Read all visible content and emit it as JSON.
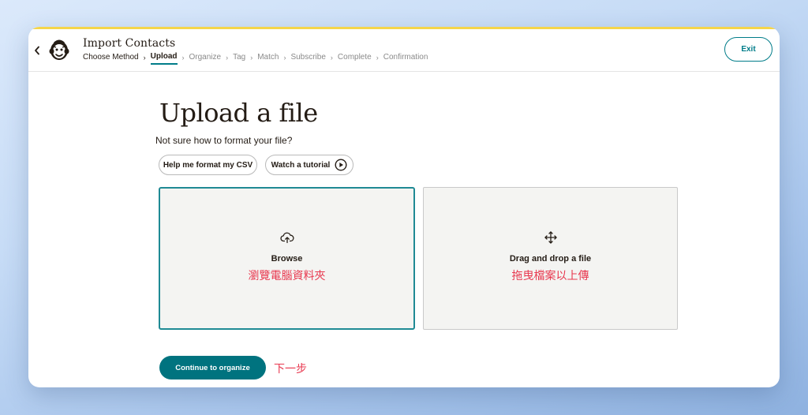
{
  "colors": {
    "accent_bar": "#f5d54a",
    "primary": "#007c89",
    "annotation": "#e8384f",
    "text": "#241c15"
  },
  "header": {
    "title": "Import Contacts",
    "back_icon": "chevron-left-icon",
    "logo": "mailchimp-logo",
    "exit_label": "Exit"
  },
  "breadcrumb": {
    "steps": [
      {
        "label": "Choose Method",
        "state": "done"
      },
      {
        "label": "Upload",
        "state": "current"
      },
      {
        "label": "Organize",
        "state": "todo"
      },
      {
        "label": "Tag",
        "state": "todo"
      },
      {
        "label": "Match",
        "state": "todo"
      },
      {
        "label": "Subscribe",
        "state": "todo"
      },
      {
        "label": "Complete",
        "state": "todo"
      },
      {
        "label": "Confirmation",
        "state": "todo"
      }
    ]
  },
  "main": {
    "heading": "Upload a file",
    "subtext": "Not sure how to format your file?",
    "help_button": "Help me format my CSV",
    "tutorial_button": "Watch a tutorial",
    "tutorial_icon": "play-circle-icon",
    "browse": {
      "icon": "cloud-upload-icon",
      "label": "Browse",
      "annotation": "瀏覽電腦資料夾"
    },
    "drag": {
      "icon": "move-arrows-icon",
      "label": "Drag and drop a file",
      "annotation": "拖曳檔案以上傳"
    },
    "continue_button": "Continue to organize",
    "continue_annotation": "下一步"
  }
}
